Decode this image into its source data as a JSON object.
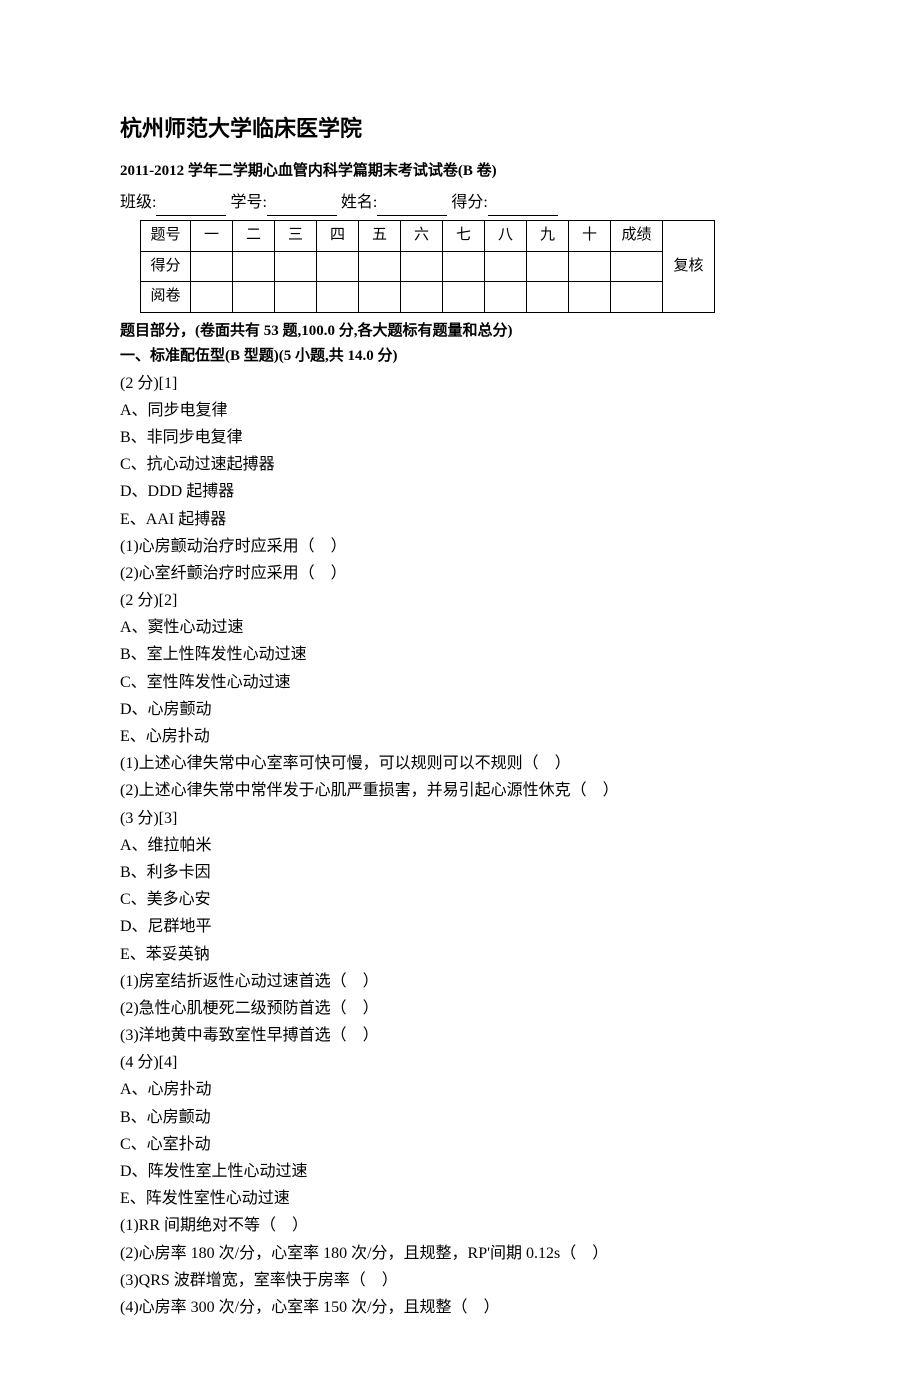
{
  "title": "杭州师范大学临床医学院",
  "subtitle": "2011-2012 学年二学期心血管内科学篇期末考试试卷(B 卷)",
  "info": {
    "class_label": "班级:",
    "id_label": "学号:",
    "name_label": "姓名:",
    "score_label": "得分:"
  },
  "table": {
    "row0": [
      "题号",
      "一",
      "二",
      "三",
      "四",
      "五",
      "六",
      "七",
      "八",
      "九",
      "十",
      "成绩",
      "复核"
    ],
    "row1_label": "得分",
    "row2_label": "阅卷"
  },
  "section_note": "题目部分，(卷面共有 53 题,100.0 分,各大题标有题量和总分)",
  "section_head": "一、标准配伍型(B 型题)(5 小题,共 14.0 分)",
  "q1": {
    "pts": "(2 分)[1]",
    "A": "A、同步电复律",
    "B": "B、非同步电复律",
    "C": "C、抗心动过速起搏器",
    "D": "D、DDD 起搏器",
    "E": "E、AAI 起搏器",
    "s1": "(1)心房颤动治疗时应采用（　）",
    "s2": "(2)心室纤颤治疗时应采用（　）"
  },
  "q2": {
    "pts": "(2 分)[2]",
    "A": "A、窦性心动过速",
    "B": "B、室上性阵发性心动过速",
    "C": "C、室性阵发性心动过速",
    "D": "D、心房颤动",
    "E": "E、心房扑动",
    "s1": "(1)上述心律失常中心室率可快可慢，可以规则可以不规则（　）",
    "s2": "(2)上述心律失常中常伴发于心肌严重损害，并易引起心源性休克（　）"
  },
  "q3": {
    "pts": "(3 分)[3]",
    "A": "A、维拉帕米",
    "B": "B、利多卡因",
    "C": "C、美多心安",
    "D": "D、尼群地平",
    "E": "E、苯妥英钠",
    "s1": "(1)房室结折返性心动过速首选（　）",
    "s2": "(2)急性心肌梗死二级预防首选（　）",
    "s3": "(3)洋地黄中毒致室性早搏首选（　）"
  },
  "q4": {
    "pts": "(4 分)[4]",
    "A": "A、心房扑动",
    "B": "B、心房颤动",
    "C": "C、心室扑动",
    "D": "D、阵发性室上性心动过速",
    "E": "E、阵发性室性心动过速",
    "s1": "(1)RR 间期绝对不等（　）",
    "s2": "(2)心房率 180 次/分，心室率 180 次/分，且规整，RP'间期 0.12s（　）",
    "s3": "(3)QRS 波群增宽，室率快于房率（　）",
    "s4": "(4)心房率 300 次/分，心室率 150 次/分，且规整（　）"
  }
}
